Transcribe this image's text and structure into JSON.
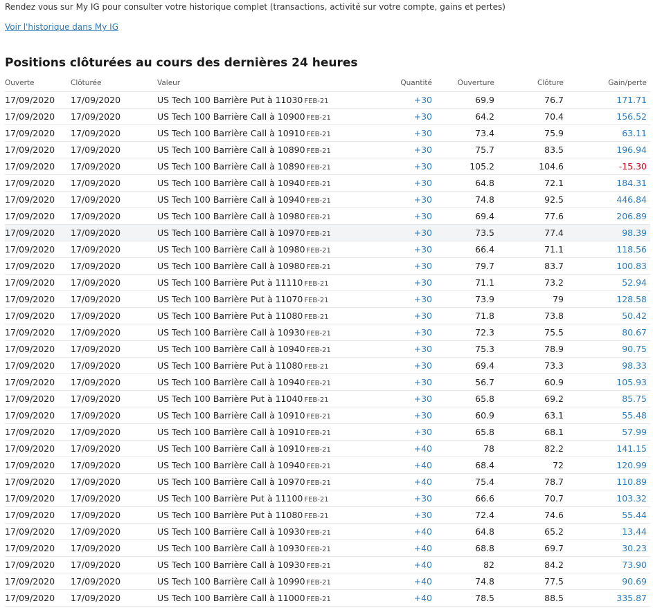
{
  "intro": {
    "text": "Rendez vous sur My IG pour consulter votre historique complet (transactions, activité sur votre compte, gains et pertes)",
    "link_label": "Voir l'historique dans My IG"
  },
  "section": {
    "title": "Positions clôturées au cours des dernières 24 heures"
  },
  "table": {
    "headers": {
      "opened": "Ouverte",
      "closed": "Clôturée",
      "market": "Valeur",
      "quantity": "Quantité",
      "open_level": "Ouverture",
      "close_level": "Clôture",
      "pnl": "Gain/perte"
    },
    "rows": [
      {
        "opened": "17/09/2020",
        "closed": "17/09/2020",
        "market": "US Tech 100 Barrière Put à 11030",
        "expiry": "FEB-21",
        "quantity": "+30",
        "open_level": "69.9",
        "close_level": "76.7",
        "pnl": "171.71",
        "pnl_sign": "pos"
      },
      {
        "opened": "17/09/2020",
        "closed": "17/09/2020",
        "market": "US Tech 100 Barrière Call à 10900",
        "expiry": "FEB-21",
        "quantity": "+30",
        "open_level": "64.2",
        "close_level": "70.4",
        "pnl": "156.52",
        "pnl_sign": "pos"
      },
      {
        "opened": "17/09/2020",
        "closed": "17/09/2020",
        "market": "US Tech 100 Barrière Call à 10910",
        "expiry": "FEB-21",
        "quantity": "+30",
        "open_level": "73.4",
        "close_level": "75.9",
        "pnl": "63.11",
        "pnl_sign": "pos"
      },
      {
        "opened": "17/09/2020",
        "closed": "17/09/2020",
        "market": "US Tech 100 Barrière Call à 10890",
        "expiry": "FEB-21",
        "quantity": "+30",
        "open_level": "75.7",
        "close_level": "83.5",
        "pnl": "196.94",
        "pnl_sign": "pos"
      },
      {
        "opened": "17/09/2020",
        "closed": "17/09/2020",
        "market": "US Tech 100 Barrière Call à 10890",
        "expiry": "FEB-21",
        "quantity": "+30",
        "open_level": "105.2",
        "close_level": "104.6",
        "pnl": "-15.30",
        "pnl_sign": "neg"
      },
      {
        "opened": "17/09/2020",
        "closed": "17/09/2020",
        "market": "US Tech 100 Barrière Call à 10940",
        "expiry": "FEB-21",
        "quantity": "+30",
        "open_level": "64.8",
        "close_level": "72.1",
        "pnl": "184.31",
        "pnl_sign": "pos"
      },
      {
        "opened": "17/09/2020",
        "closed": "17/09/2020",
        "market": "US Tech 100 Barrière Call à 10940",
        "expiry": "FEB-21",
        "quantity": "+30",
        "open_level": "74.8",
        "close_level": "92.5",
        "pnl": "446.84",
        "pnl_sign": "pos"
      },
      {
        "opened": "17/09/2020",
        "closed": "17/09/2020",
        "market": "US Tech 100 Barrière Call à 10980",
        "expiry": "FEB-21",
        "quantity": "+30",
        "open_level": "69.4",
        "close_level": "77.6",
        "pnl": "206.89",
        "pnl_sign": "pos"
      },
      {
        "opened": "17/09/2020",
        "closed": "17/09/2020",
        "market": "US Tech 100 Barrière Call à 10970",
        "expiry": "FEB-21",
        "quantity": "+30",
        "open_level": "73.5",
        "close_level": "77.4",
        "pnl": "98.39",
        "pnl_sign": "pos",
        "highlighted": true
      },
      {
        "opened": "17/09/2020",
        "closed": "17/09/2020",
        "market": "US Tech 100 Barrière Call à 10980",
        "expiry": "FEB-21",
        "quantity": "+30",
        "open_level": "66.4",
        "close_level": "71.1",
        "pnl": "118.56",
        "pnl_sign": "pos"
      },
      {
        "opened": "17/09/2020",
        "closed": "17/09/2020",
        "market": "US Tech 100 Barrière Call à 10980",
        "expiry": "FEB-21",
        "quantity": "+30",
        "open_level": "79.7",
        "close_level": "83.7",
        "pnl": "100.83",
        "pnl_sign": "pos"
      },
      {
        "opened": "17/09/2020",
        "closed": "17/09/2020",
        "market": "US Tech 100 Barrière Put à 11110",
        "expiry": "FEB-21",
        "quantity": "+30",
        "open_level": "71.1",
        "close_level": "73.2",
        "pnl": "52.94",
        "pnl_sign": "pos"
      },
      {
        "opened": "17/09/2020",
        "closed": "17/09/2020",
        "market": "US Tech 100 Barrière Put à 11070",
        "expiry": "FEB-21",
        "quantity": "+30",
        "open_level": "73.9",
        "close_level": "79",
        "pnl": "128.58",
        "pnl_sign": "pos"
      },
      {
        "opened": "17/09/2020",
        "closed": "17/09/2020",
        "market": "US Tech 100 Barrière Put à 11080",
        "expiry": "FEB-21",
        "quantity": "+30",
        "open_level": "71.8",
        "close_level": "73.8",
        "pnl": "50.42",
        "pnl_sign": "pos"
      },
      {
        "opened": "17/09/2020",
        "closed": "17/09/2020",
        "market": "US Tech 100 Barrière Call à 10930",
        "expiry": "FEB-21",
        "quantity": "+30",
        "open_level": "72.3",
        "close_level": "75.5",
        "pnl": "80.67",
        "pnl_sign": "pos"
      },
      {
        "opened": "17/09/2020",
        "closed": "17/09/2020",
        "market": "US Tech 100 Barrière Call à 10940",
        "expiry": "FEB-21",
        "quantity": "+30",
        "open_level": "75.3",
        "close_level": "78.9",
        "pnl": "90.75",
        "pnl_sign": "pos"
      },
      {
        "opened": "17/09/2020",
        "closed": "17/09/2020",
        "market": "US Tech 100 Barrière Put à 11080",
        "expiry": "FEB-21",
        "quantity": "+30",
        "open_level": "69.4",
        "close_level": "73.3",
        "pnl": "98.33",
        "pnl_sign": "pos"
      },
      {
        "opened": "17/09/2020",
        "closed": "17/09/2020",
        "market": "US Tech 100 Barrière Call à 10940",
        "expiry": "FEB-21",
        "quantity": "+30",
        "open_level": "56.7",
        "close_level": "60.9",
        "pnl": "105.93",
        "pnl_sign": "pos"
      },
      {
        "opened": "17/09/2020",
        "closed": "17/09/2020",
        "market": "US Tech 100 Barrière Put à 11040",
        "expiry": "FEB-21",
        "quantity": "+30",
        "open_level": "65.8",
        "close_level": "69.2",
        "pnl": "85.75",
        "pnl_sign": "pos"
      },
      {
        "opened": "17/09/2020",
        "closed": "17/09/2020",
        "market": "US Tech 100 Barrière Call à 10910",
        "expiry": "FEB-21",
        "quantity": "+30",
        "open_level": "60.9",
        "close_level": "63.1",
        "pnl": "55.48",
        "pnl_sign": "pos"
      },
      {
        "opened": "17/09/2020",
        "closed": "17/09/2020",
        "market": "US Tech 100 Barrière Call à 10910",
        "expiry": "FEB-21",
        "quantity": "+30",
        "open_level": "65.8",
        "close_level": "68.1",
        "pnl": "57.99",
        "pnl_sign": "pos"
      },
      {
        "opened": "17/09/2020",
        "closed": "17/09/2020",
        "market": "US Tech 100 Barrière Call à 10910",
        "expiry": "FEB-21",
        "quantity": "+40",
        "open_level": "78",
        "close_level": "82.2",
        "pnl": "141.15",
        "pnl_sign": "pos"
      },
      {
        "opened": "17/09/2020",
        "closed": "17/09/2020",
        "market": "US Tech 100 Barrière Call à 10940",
        "expiry": "FEB-21",
        "quantity": "+40",
        "open_level": "68.4",
        "close_level": "72",
        "pnl": "120.99",
        "pnl_sign": "pos"
      },
      {
        "opened": "17/09/2020",
        "closed": "17/09/2020",
        "market": "US Tech 100 Barrière Call à 10970",
        "expiry": "FEB-21",
        "quantity": "+40",
        "open_level": "75.4",
        "close_level": "78.7",
        "pnl": "110.89",
        "pnl_sign": "pos"
      },
      {
        "opened": "17/09/2020",
        "closed": "17/09/2020",
        "market": "US Tech 100 Barrière Put à 11100",
        "expiry": "FEB-21",
        "quantity": "+30",
        "open_level": "66.6",
        "close_level": "70.7",
        "pnl": "103.32",
        "pnl_sign": "pos"
      },
      {
        "opened": "17/09/2020",
        "closed": "17/09/2020",
        "market": "US Tech 100 Barrière Put à 11080",
        "expiry": "FEB-21",
        "quantity": "+30",
        "open_level": "72.4",
        "close_level": "74.6",
        "pnl": "55.44",
        "pnl_sign": "pos"
      },
      {
        "opened": "17/09/2020",
        "closed": "17/09/2020",
        "market": "US Tech 100 Barrière Call à 10930",
        "expiry": "FEB-21",
        "quantity": "+40",
        "open_level": "64.8",
        "close_level": "65.2",
        "pnl": "13.44",
        "pnl_sign": "pos"
      },
      {
        "opened": "17/09/2020",
        "closed": "17/09/2020",
        "market": "US Tech 100 Barrière Call à 10930",
        "expiry": "FEB-21",
        "quantity": "+40",
        "open_level": "68.8",
        "close_level": "69.7",
        "pnl": "30.23",
        "pnl_sign": "pos"
      },
      {
        "opened": "17/09/2020",
        "closed": "17/09/2020",
        "market": "US Tech 100 Barrière Call à 10930",
        "expiry": "FEB-21",
        "quantity": "+40",
        "open_level": "82",
        "close_level": "84.2",
        "pnl": "73.90",
        "pnl_sign": "pos"
      },
      {
        "opened": "17/09/2020",
        "closed": "17/09/2020",
        "market": "US Tech 100 Barrière Call à 10990",
        "expiry": "FEB-21",
        "quantity": "+40",
        "open_level": "74.8",
        "close_level": "77.5",
        "pnl": "90.69",
        "pnl_sign": "pos"
      },
      {
        "opened": "17/09/2020",
        "closed": "17/09/2020",
        "market": "US Tech 100 Barrière Call à 11000",
        "expiry": "FEB-21",
        "quantity": "+40",
        "open_level": "78.5",
        "close_level": "88.5",
        "pnl": "335.87",
        "pnl_sign": "pos"
      }
    ]
  },
  "colors": {
    "link": "#2b7bb9",
    "quantity": "#2b7bb9",
    "gain_positive": "#2b7bb9",
    "gain_negative": "#d0021b",
    "row_highlight": "#f2f4f6",
    "divider": "#e6e6e6"
  }
}
